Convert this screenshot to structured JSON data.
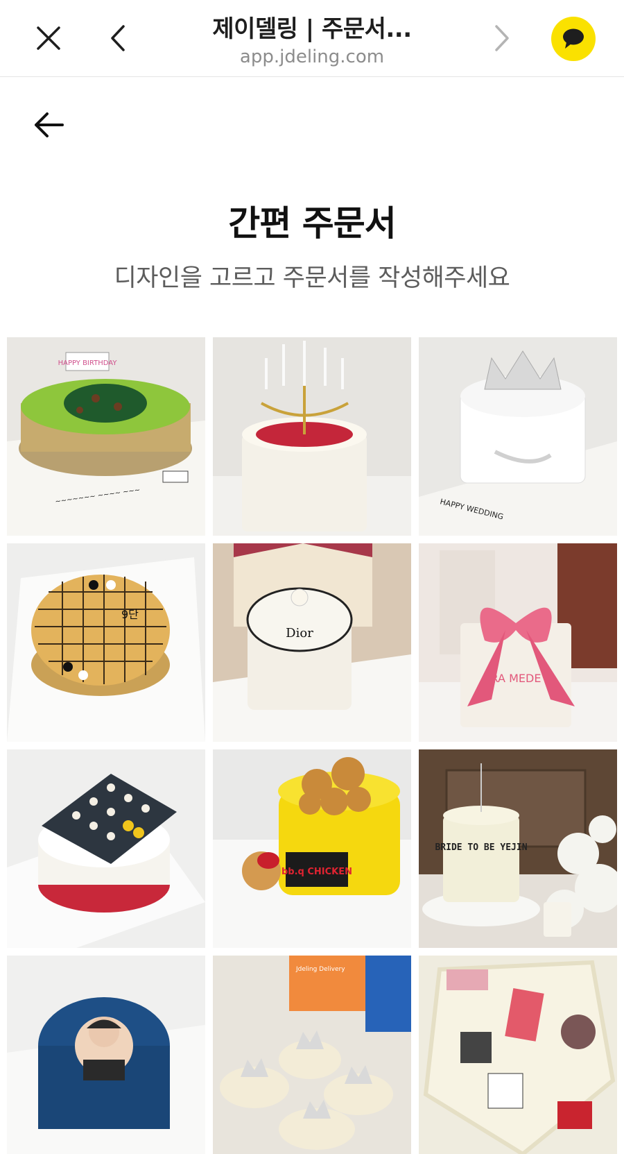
{
  "browser": {
    "title": "제이델링 | 주문서...",
    "url": "app.jdeling.com"
  },
  "icons": {
    "close": "close-icon",
    "back": "chevron-left-icon",
    "forward": "chevron-right-icon",
    "talk": "kakaotalk-chat-icon",
    "page_back": "arrow-left-icon"
  },
  "colors": {
    "kakao_yellow": "#fae100",
    "title_text": "#111111",
    "subtitle_text": "#5c5c5c"
  },
  "page": {
    "title": "간편 주문서",
    "subtitle": "디자인을 고르고 주문서를 작성해주세요"
  },
  "designs": [
    {
      "text": "HAPPY BIRTHDAY"
    },
    {
      "text": ""
    },
    {
      "text": "HAPPY WEDDING"
    },
    {
      "text": "9단"
    },
    {
      "text": "Dior"
    },
    {
      "text": "RA MEDE"
    },
    {
      "text": ""
    },
    {
      "text": "bb.q CHICKEN"
    },
    {
      "text": "BRIDE TO BE YEJIN"
    },
    {
      "text": ""
    },
    {
      "text": "Jdeling Delivery"
    },
    {
      "text": ""
    }
  ]
}
